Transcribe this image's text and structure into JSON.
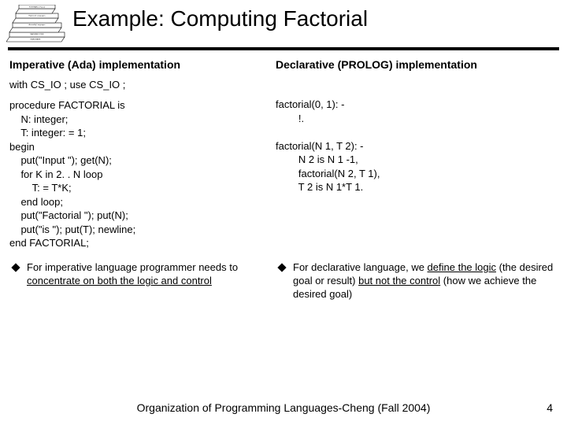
{
  "title": "Example: Computing Factorial",
  "left": {
    "heading": "Imperative (Ada) implementation",
    "with": "with CS_IO ; use CS_IO ;",
    "code": "procedure FACTORIAL is\n    N: integer;\n    T: integer: = 1;\nbegin\n    put(\"Input \"); get(N);\n    for K in 2. . N loop\n        T: = T*K;\n    end loop;\n    put(\"Factorial \"); put(N);\n    put(\"is \"); put(T); newline;\nend FACTORIAL;",
    "bullet_pre": "For imperative language programmer needs to ",
    "bullet_u": "concentrate on both the logic and control"
  },
  "right": {
    "heading": "Declarative (PROLOG) implementation",
    "code": "factorial(0, 1): -\n        !.\n\nfactorial(N 1, T 2): -\n        N 2 is N 1 -1,\n        factorial(N 2, T 1),\n        T 2 is N 1*T 1.",
    "bullet_pre": "For declarative language, we ",
    "bullet_u1": "define the logic",
    "bullet_mid": " (the desired goal or result) ",
    "bullet_u2": "but not the control",
    "bullet_post": " (how we achieve the desired goal)"
  },
  "footer": "Organization of Programming Languages-Cheng (Fall 2004)",
  "page": "4"
}
